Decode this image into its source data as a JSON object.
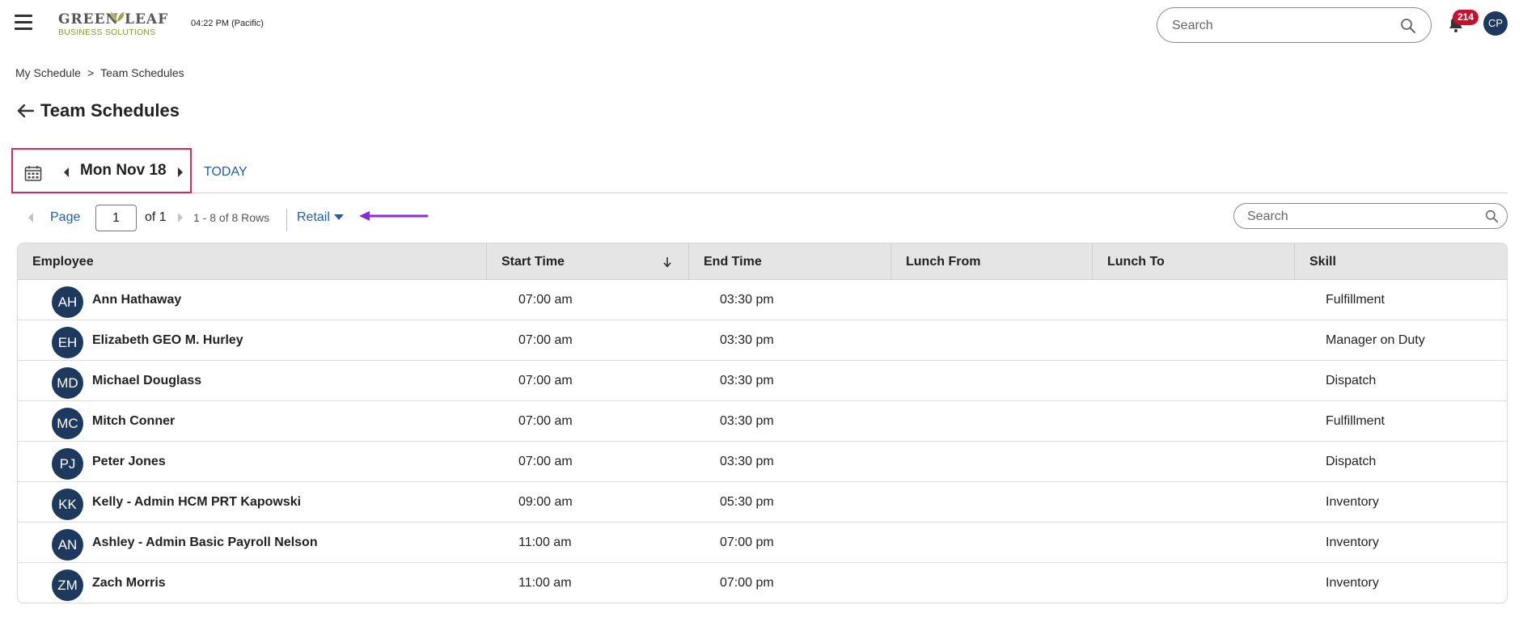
{
  "header": {
    "logo_top": "GREEN LEAF",
    "logo_sub": "BUSINESS SOLUTIONS",
    "clock": "04:22 PM (Pacific)",
    "search_placeholder": "Search",
    "notification_count": "214",
    "user_initials": "CP"
  },
  "breadcrumb": {
    "items": [
      "My Schedule",
      "Team Schedules"
    ],
    "separator": ">"
  },
  "page": {
    "title": "Team Schedules"
  },
  "date_nav": {
    "date": "Mon Nov 18",
    "today_label": "TODAY"
  },
  "pager": {
    "page_label": "Page",
    "page_value": "1",
    "of_label": "of 1",
    "rows_label": "1 - 8 of 8 Rows",
    "filter_label": "Retail",
    "search_placeholder": "Search"
  },
  "table": {
    "columns": [
      "Employee",
      "Start Time",
      "End Time",
      "Lunch From",
      "Lunch To",
      "Skill"
    ],
    "sorted_column": "Start Time",
    "rows": [
      {
        "initials": "AH",
        "name": "Ann Hathaway",
        "start": "07:00 am",
        "end": "03:30 pm",
        "lunch_from": "",
        "lunch_to": "",
        "skill": "Fulfillment"
      },
      {
        "initials": "EH",
        "name": "Elizabeth GEO M. Hurley",
        "start": "07:00 am",
        "end": "03:30 pm",
        "lunch_from": "",
        "lunch_to": "",
        "skill": "Manager on Duty"
      },
      {
        "initials": "MD",
        "name": "Michael Douglass",
        "start": "07:00 am",
        "end": "03:30 pm",
        "lunch_from": "",
        "lunch_to": "",
        "skill": "Dispatch"
      },
      {
        "initials": "MC",
        "name": "Mitch Conner",
        "start": "07:00 am",
        "end": "03:30 pm",
        "lunch_from": "",
        "lunch_to": "",
        "skill": "Fulfillment"
      },
      {
        "initials": "PJ",
        "name": "Peter Jones",
        "start": "07:00 am",
        "end": "03:30 pm",
        "lunch_from": "",
        "lunch_to": "",
        "skill": "Dispatch"
      },
      {
        "initials": "KK",
        "name": "Kelly - Admin HCM PRT Kapowski",
        "start": "09:00 am",
        "end": "05:30 pm",
        "lunch_from": "",
        "lunch_to": "",
        "skill": "Inventory"
      },
      {
        "initials": "AN",
        "name": "Ashley - Admin Basic Payroll Nelson",
        "start": "11:00 am",
        "end": "07:00 pm",
        "lunch_from": "",
        "lunch_to": "",
        "skill": "Inventory"
      },
      {
        "initials": "ZM",
        "name": "Zach Morris",
        "start": "11:00 am",
        "end": "07:00 pm",
        "lunch_from": "",
        "lunch_to": "",
        "skill": "Inventory"
      }
    ]
  },
  "colors": {
    "accent_blue": "#1f5fa8",
    "avatar_navy": "#1d3a5e",
    "badge_red": "#c8102e",
    "highlight_pink": "#e0245e",
    "annotation_purple": "#8a2be2",
    "annotation_blue": "#2f6fe4",
    "annotation_green": "#22c55e",
    "annotation_orange": "#f59316"
  }
}
